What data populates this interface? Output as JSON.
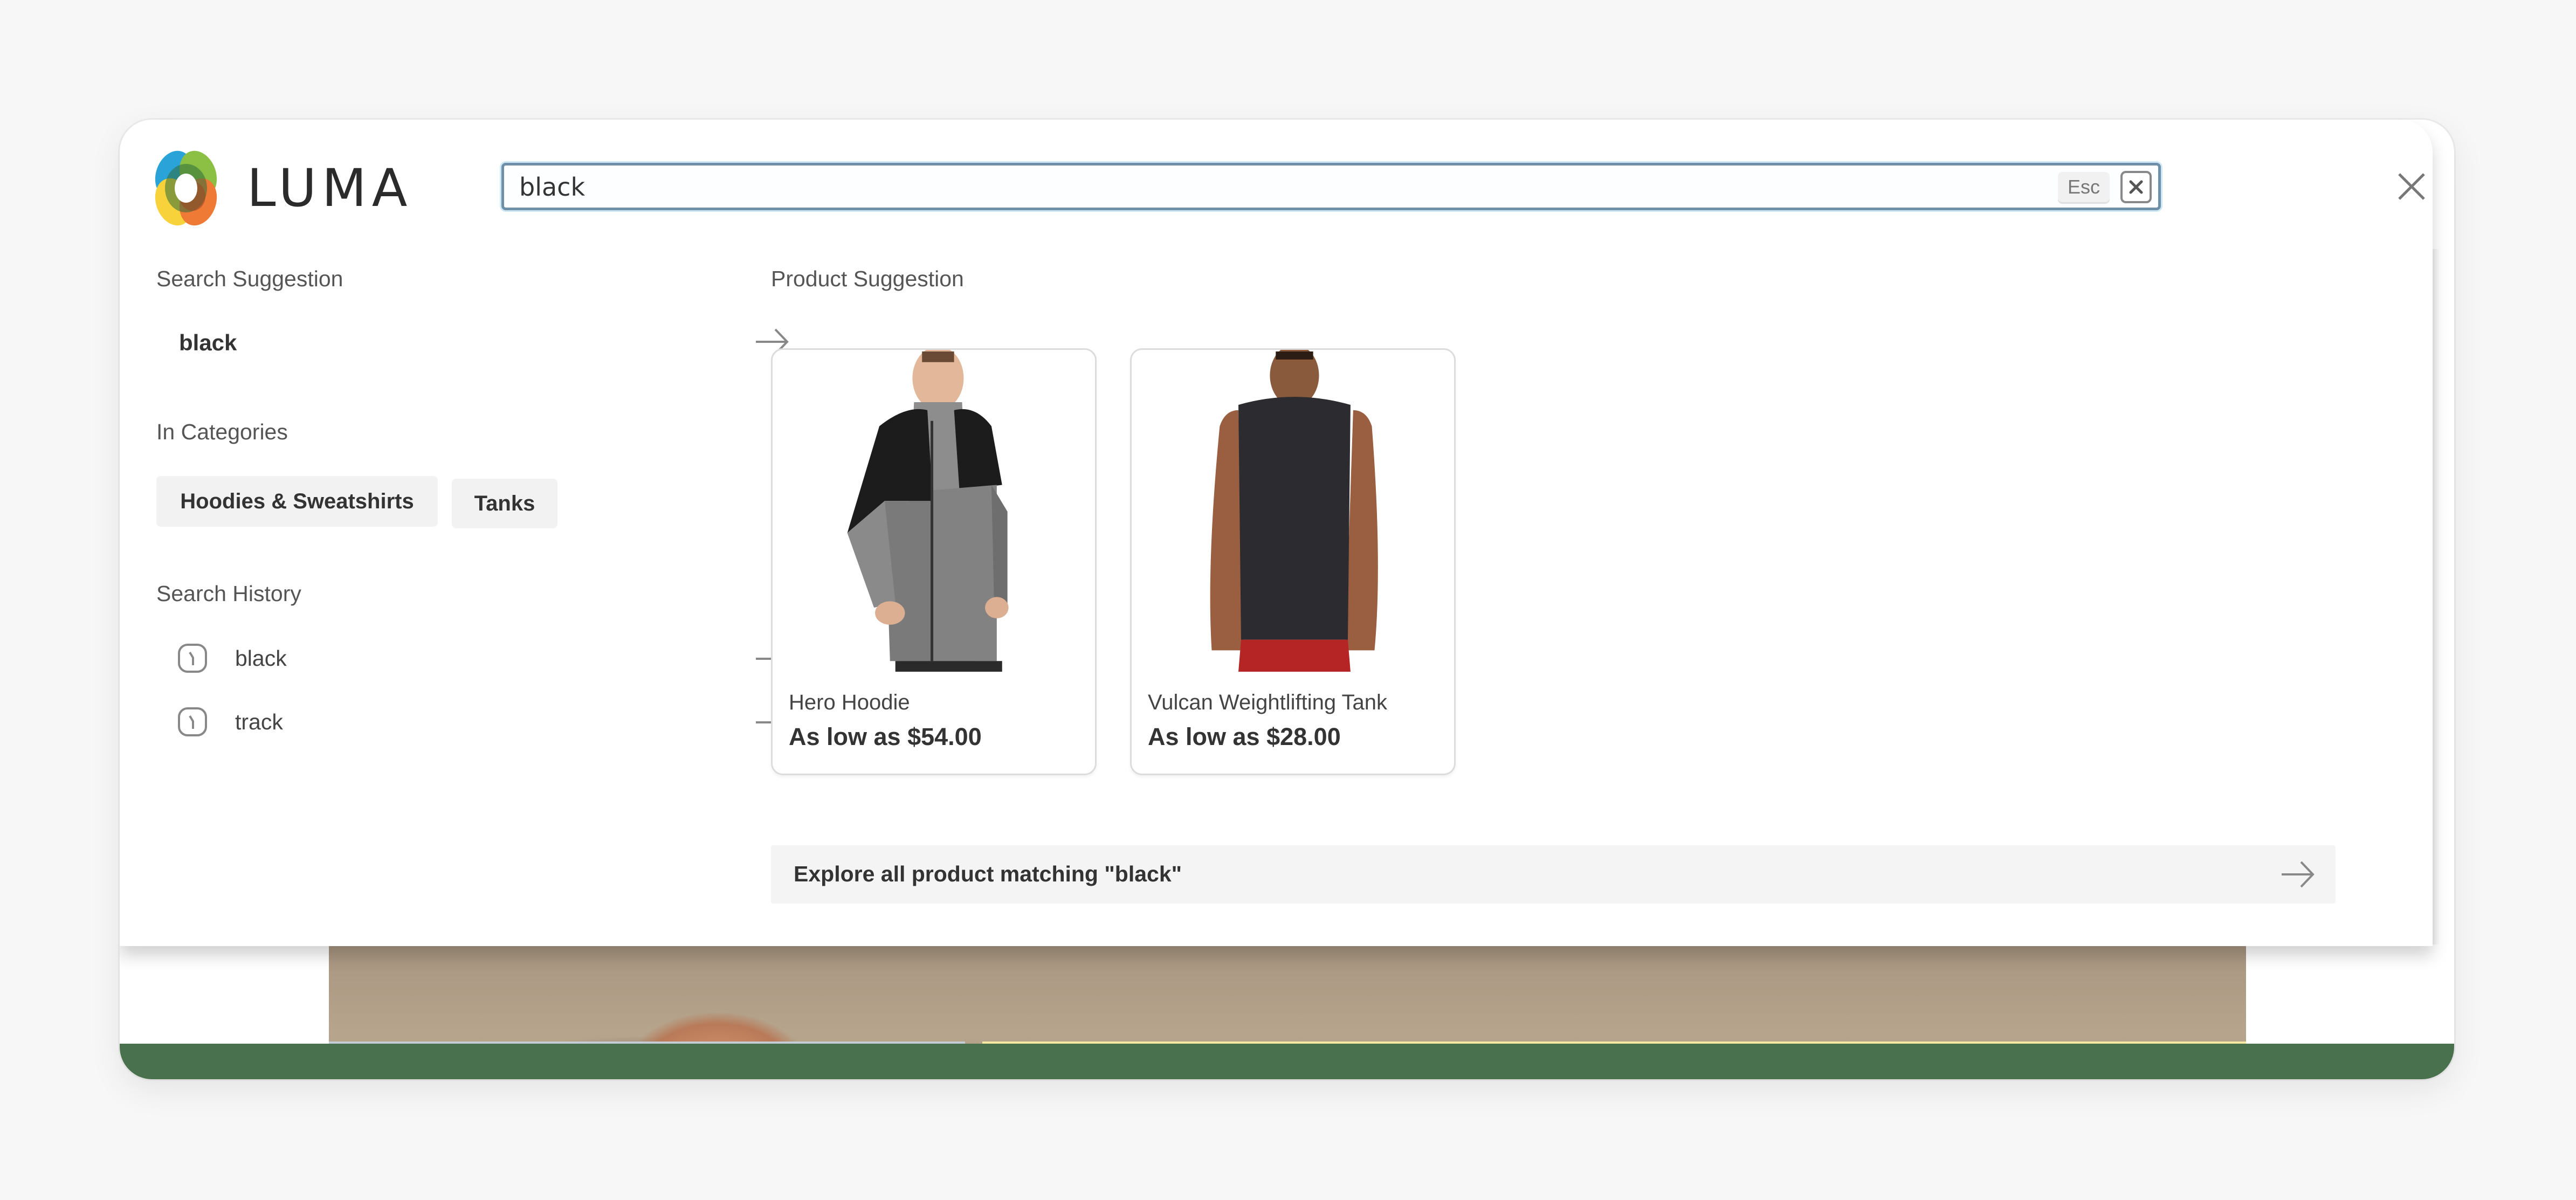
{
  "brand": {
    "name": "LUMA"
  },
  "search": {
    "value": "black",
    "esc_label": "Esc"
  },
  "search_suggestion": {
    "title": "Search Suggestion",
    "items": [
      {
        "label": "black"
      }
    ]
  },
  "categories": {
    "title": "In Categories",
    "items": [
      {
        "label": "Hoodies & Sweatshirts"
      },
      {
        "label": "Tanks"
      }
    ]
  },
  "history": {
    "title": "Search History",
    "items": [
      {
        "label": "black"
      },
      {
        "label": "track"
      }
    ]
  },
  "products": {
    "title": "Product Suggestion",
    "items": [
      {
        "name": "Hero Hoodie",
        "price": "As low as $54.00"
      },
      {
        "name": "Vulcan Weightlifting Tank",
        "price": "As low as $28.00"
      }
    ]
  },
  "explore": {
    "label": "Explore all product matching \"black\""
  },
  "colors": {
    "accent_border": "#6f8fa8",
    "footer_green": "#4a714d",
    "chip_bg": "#f2f2f2"
  }
}
